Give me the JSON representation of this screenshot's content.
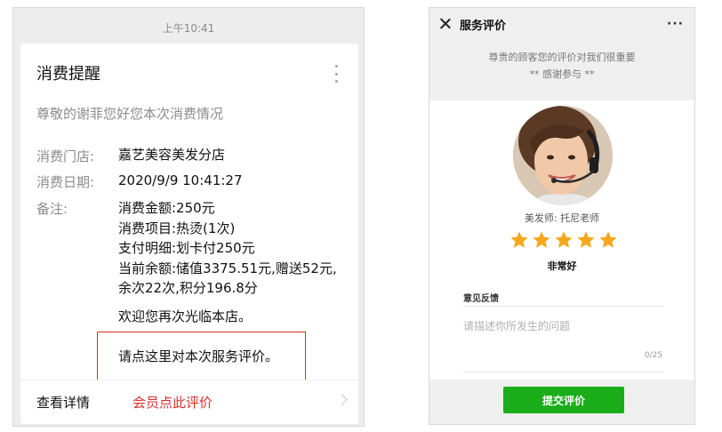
{
  "left": {
    "status_time": "上午10:41",
    "card_title": "消费提醒",
    "greeting": "尊敬的谢菲您好您本次消费情况",
    "store_label": "消费门店:",
    "store_value": "嘉艺美容美发分店",
    "date_label": "消费日期:",
    "date_value": "2020/9/9 10:41:27",
    "notes_label": "备注:",
    "notes_lines": [
      "消费金额:250元",
      "消费项目:热烫(1次)",
      "支付明细:划卡付250元",
      "当前余额:储值3375.51元,赠送52元,",
      "余次22次,积分196.8分"
    ],
    "welcome": "欢迎您再次光临本店。",
    "review_prompt": "请点这里对本次服务评价。",
    "view_details": "查看详情",
    "member_review": "会员点此评价",
    "colors": {
      "highlight": "#d9322b"
    }
  },
  "right": {
    "title": "服务评价",
    "more": "···",
    "intro_line1": "尊贵的顾客您的评价对我们很重要",
    "intro_line2": "** 感谢参与 **",
    "stylist": "美发师: 托尼老师",
    "rating": 5,
    "rating_text": "非常好",
    "feedback_label": "意见反馈",
    "feedback_placeholder": "请描述你所发生的问题",
    "char_count": "0/25",
    "submit_label": "提交评价",
    "colors": {
      "star": "#f7a71b",
      "submit": "#1aad19"
    }
  }
}
